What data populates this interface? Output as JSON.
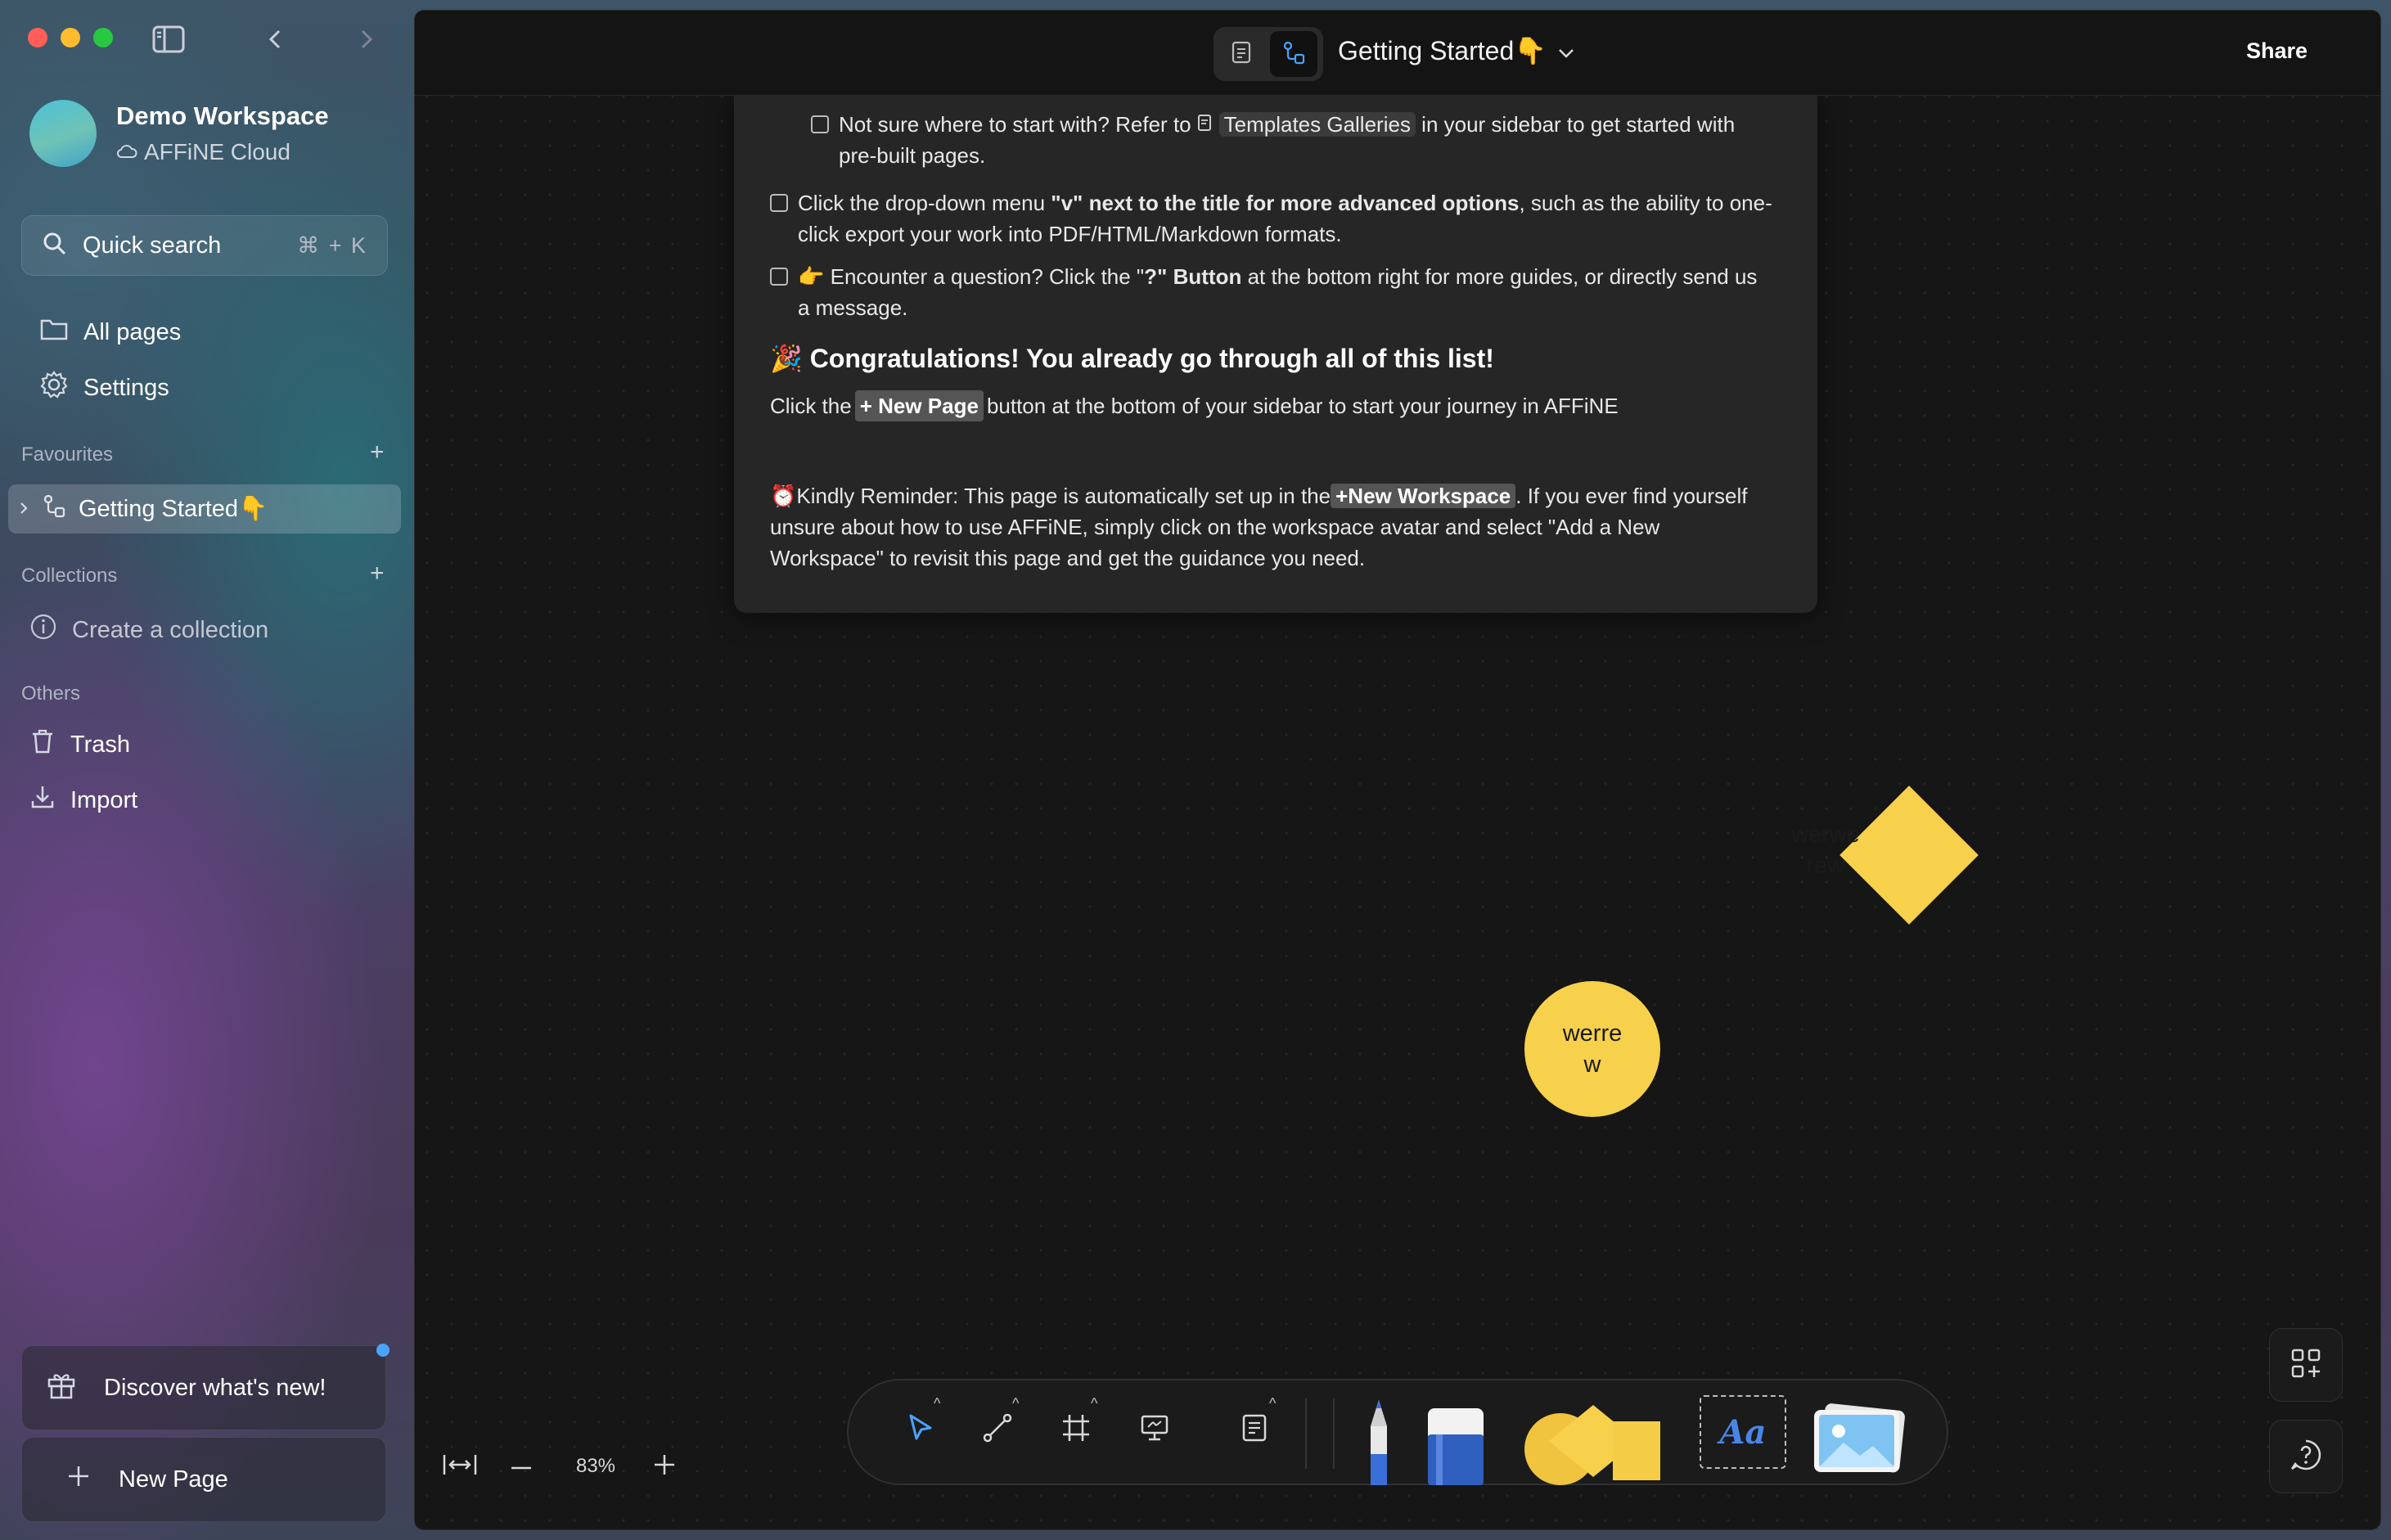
{
  "sidebar": {
    "workspace": {
      "name": "Demo Workspace",
      "cloud_label": "AFFiNE Cloud"
    },
    "search": {
      "label": "Quick search",
      "shortcut": "⌘ + K"
    },
    "nav": [
      {
        "label": "All pages",
        "icon": "folder-icon"
      },
      {
        "label": "Settings",
        "icon": "gear-icon"
      }
    ],
    "favourites": {
      "title": "Favourites",
      "items": [
        {
          "label": "Getting Started👇"
        }
      ]
    },
    "collections": {
      "title": "Collections",
      "create_label": "Create a collection"
    },
    "others": {
      "title": "Others",
      "items": [
        {
          "label": "Trash"
        },
        {
          "label": "Import"
        }
      ]
    },
    "discover_label": "Discover what's new!",
    "new_page_label": "New Page"
  },
  "header": {
    "title": "Getting Started👇",
    "share_label": "Share",
    "active_mode": "edgeless"
  },
  "note": {
    "item1": {
      "part1": "Not sure where to start with? Refer to",
      "chip": "Templates Galleries",
      "part2": "in your sidebar to get started with",
      "line2": "pre-built pages."
    },
    "item2": {
      "part1": "Click the drop-down menu ",
      "bold": "\"v\" next to the title for more advanced options",
      "part2": ", such as the ability to one-",
      "line2": "click export your work into PDF/HTML/Markdown formats."
    },
    "item3": {
      "part1": "👉 Encounter a question?  Click the \"",
      "bold": "?\" Button",
      "part2": " at the bottom right for more guides, or directly send us",
      "line2": "a message."
    },
    "heading": "🎉 Congratulations! You already go through all of this list!",
    "new_page_line": {
      "part1": "Click the",
      "tag": "+ New Page",
      "part2": "button at the bottom of your sidebar to start your journey in AFFiNE"
    },
    "reminder": {
      "part1": "⏰Kindly Reminder: This page is automatically set up in the",
      "tag": "+New Workspace",
      "part2": ". If you ever find yourself",
      "line2": "unsure about how to use AFFiNE, simply click on the workspace avatar and select \"Add a New",
      "line3": "Workspace\" to revisit this page and get the guidance you need."
    }
  },
  "canvas": {
    "diamond": {
      "line1": "werwe",
      "line2": "rew",
      "color": "#f7d14b"
    },
    "circle": {
      "line1": "werre",
      "line2": "w",
      "color": "#f7d14b"
    }
  },
  "zoom": {
    "level": "83%"
  },
  "toolbar": {
    "tools": [
      "pointer-icon",
      "connector-icon",
      "frame-icon",
      "presentation-icon",
      "note-icon",
      "pencil-icon",
      "eraser-icon",
      "shape-icon",
      "text-icon",
      "image-icon"
    ],
    "text_tool_label": "Aa"
  },
  "colors": {
    "accent": "#4aa3ff",
    "shape_yellow": "#f7d14b"
  }
}
